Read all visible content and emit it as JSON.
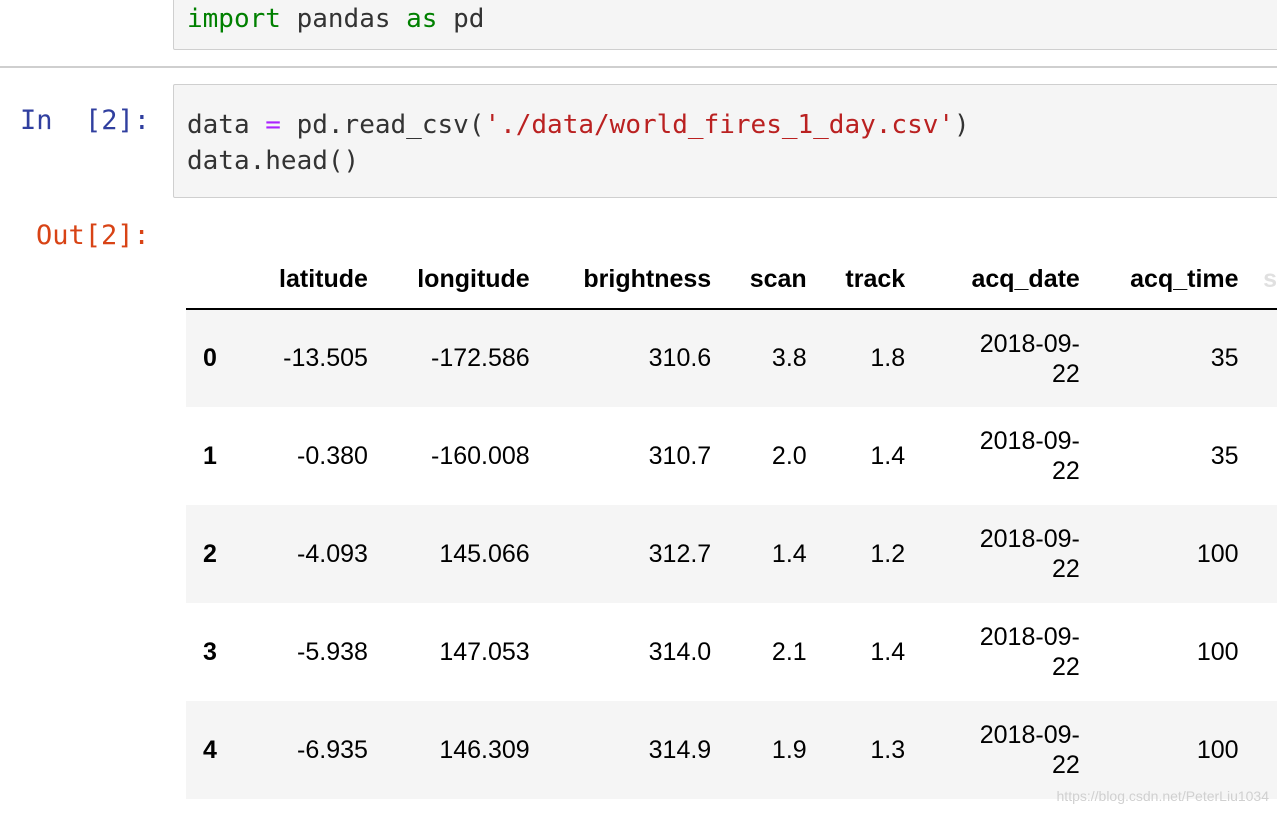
{
  "cell1": {
    "code": {
      "kw_import": "import",
      "module": " pandas ",
      "kw_as": "as",
      "alias": " pd"
    }
  },
  "cell2": {
    "prompt": "In  [2]:",
    "line1": {
      "target": "data ",
      "op": "=",
      "call": " pd.read_csv(",
      "arg": "'./data/world_fires_1_day.csv'",
      "close": ")"
    },
    "line2": "data.head()"
  },
  "output": {
    "prompt": "Out[2]:",
    "columns": [
      "latitude",
      "longitude",
      "brightness",
      "scan",
      "track",
      "acq_date",
      "acq_time",
      "s"
    ],
    "rows": [
      {
        "index": "0",
        "latitude": "-13.505",
        "longitude": "-172.586",
        "brightness": "310.6",
        "scan": "3.8",
        "track": "1.8",
        "date1": "2018-09-",
        "date2": "22",
        "acq_time": "35"
      },
      {
        "index": "1",
        "latitude": "-0.380",
        "longitude": "-160.008",
        "brightness": "310.7",
        "scan": "2.0",
        "track": "1.4",
        "date1": "2018-09-",
        "date2": "22",
        "acq_time": "35"
      },
      {
        "index": "2",
        "latitude": "-4.093",
        "longitude": "145.066",
        "brightness": "312.7",
        "scan": "1.4",
        "track": "1.2",
        "date1": "2018-09-",
        "date2": "22",
        "acq_time": "100"
      },
      {
        "index": "3",
        "latitude": "-5.938",
        "longitude": "147.053",
        "brightness": "314.0",
        "scan": "2.1",
        "track": "1.4",
        "date1": "2018-09-",
        "date2": "22",
        "acq_time": "100"
      },
      {
        "index": "4",
        "latitude": "-6.935",
        "longitude": "146.309",
        "brightness": "314.9",
        "scan": "1.9",
        "track": "1.3",
        "date1": "2018-09-",
        "date2": "22",
        "acq_time": "100"
      }
    ]
  },
  "watermark": "https://blog.csdn.net/PeterLiu1034",
  "colors": {
    "in_prompt": "#303f9f",
    "out_prompt": "#d84315",
    "keyword": "#008000",
    "string": "#ba2121",
    "operator": "#aa22ff"
  }
}
